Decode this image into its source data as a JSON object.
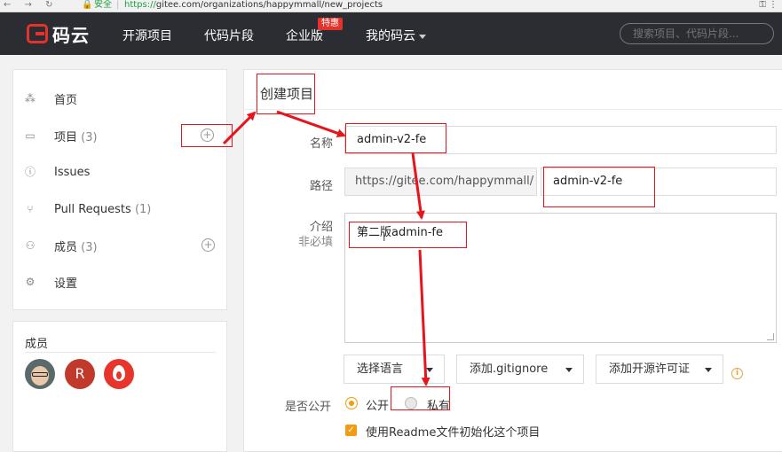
{
  "browser": {
    "nav_glyphs": "← → ↻",
    "lock": "🔒",
    "secure_label": "安全",
    "url_protocol": "https://",
    "url_rest": "gitee.com/organizations/happymmall/new_projects",
    "key_glyph": "⚿",
    "menu_glyph": "⋮"
  },
  "header": {
    "logo_text": "码云",
    "nav": [
      "开源项目",
      "代码片段",
      "企业版",
      "我的码云"
    ],
    "badge": "特惠",
    "search_placeholder": "搜索项目、代码片段..."
  },
  "sidebar": {
    "items": [
      {
        "label": "首页",
        "count": "",
        "icon": "home-icon"
      },
      {
        "label": "项目",
        "count": "(3)",
        "icon": "folder-icon"
      },
      {
        "label": "Issues",
        "count": "",
        "icon": "issue-icon"
      },
      {
        "label": "Pull Requests",
        "count": "(1)",
        "icon": "pull-request-icon"
      },
      {
        "label": "成员",
        "count": "(3)",
        "icon": "members-icon"
      },
      {
        "label": "设置",
        "count": "",
        "icon": "gear-icon"
      }
    ],
    "plus_glyph": "+"
  },
  "members": {
    "title": "成员",
    "avatar_letter": "R"
  },
  "form": {
    "title": "创建项目",
    "name_label": "名称",
    "name_value": "admin-v2-fe",
    "path_label": "路径",
    "path_prefix": "https://gitee.com/happymmall/",
    "path_value": "admin-v2-fe",
    "desc_label": "介绍",
    "desc_optional": "非必填",
    "desc_value": "第二版admin-fe",
    "text_cursor": "I",
    "language_select": "选择语言",
    "gitignore_select": "添加.gitignore",
    "license_select": "添加开源许可证",
    "info_glyph": "i",
    "public_label": "是否公开",
    "public_option": "公开",
    "private_option": "私有",
    "readme_label": "使用Readme文件初始化这个项目",
    "check_glyph": "✓"
  },
  "colors": {
    "header_bg": "#2b2d33",
    "brand_red": "#e3332a",
    "accent_orange": "#f39c12",
    "annotation_red": "#e8141c"
  }
}
